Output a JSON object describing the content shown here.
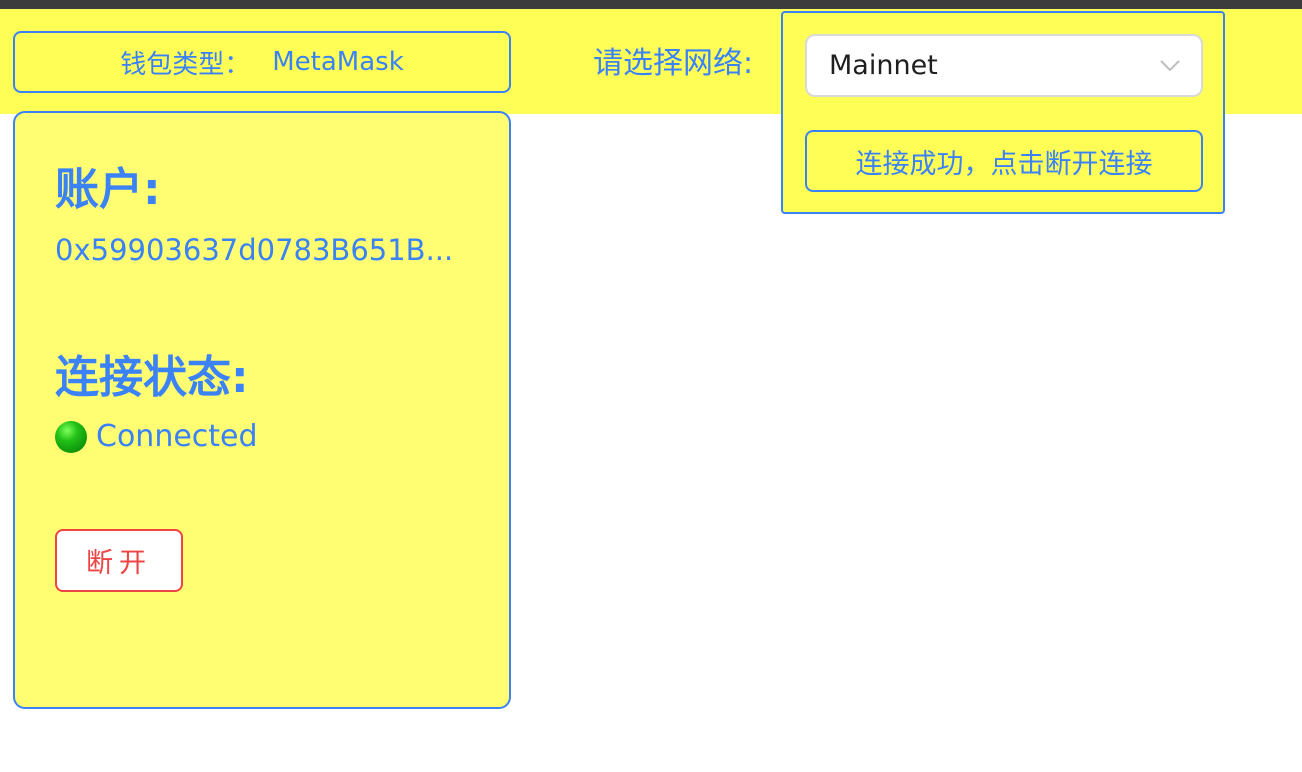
{
  "wallet": {
    "label": "钱包类型：",
    "value": "MetaMask"
  },
  "network": {
    "label": "请选择网络:",
    "selected": "Mainnet",
    "status_button_label": "连接成功，点击断开连接"
  },
  "account": {
    "heading": "账户:",
    "address": "0x59903637d0783B651B..."
  },
  "connection": {
    "heading": "连接状态:",
    "status_text": "Connected",
    "status_icon": "green-circle-icon"
  },
  "actions": {
    "disconnect_label": "断开"
  },
  "colors": {
    "accent": "#3b82f6",
    "panel_bg": "#fffe57",
    "danger": "#ef4444"
  }
}
